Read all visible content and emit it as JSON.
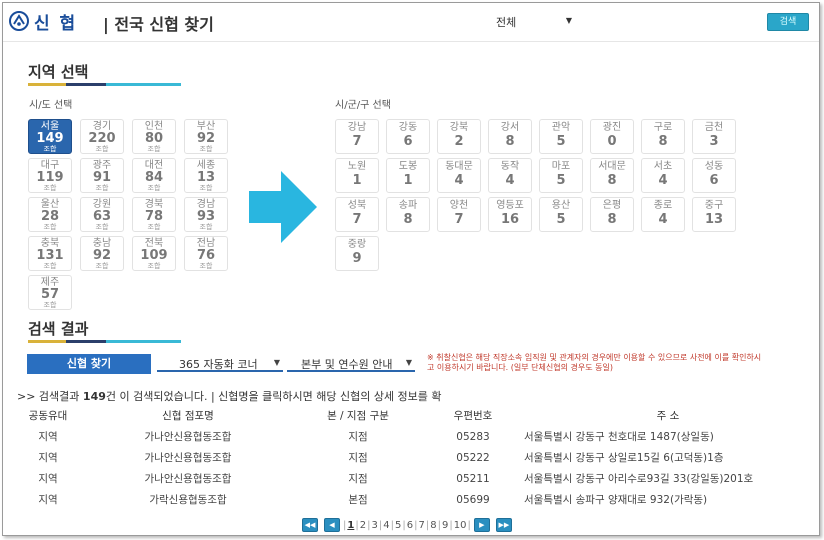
{
  "header": {
    "logo_text": "신 협",
    "title": "| 전국 신협 찾기",
    "region_select": "전체",
    "search_button": "검색"
  },
  "region_section": {
    "title": "지역 선택",
    "sido_label": "시/도 선택",
    "gu_label": "시/군/구 선택",
    "unit": "조합",
    "sido": [
      {
        "name": "서울",
        "count": "149",
        "selected": true
      },
      {
        "name": "경기",
        "count": "220"
      },
      {
        "name": "인천",
        "count": "80"
      },
      {
        "name": "부산",
        "count": "92"
      },
      {
        "name": "대구",
        "count": "119"
      },
      {
        "name": "광주",
        "count": "91"
      },
      {
        "name": "대전",
        "count": "84"
      },
      {
        "name": "세종",
        "count": "13"
      },
      {
        "name": "울산",
        "count": "28"
      },
      {
        "name": "강원",
        "count": "63"
      },
      {
        "name": "경북",
        "count": "78"
      },
      {
        "name": "경남",
        "count": "93"
      },
      {
        "name": "충북",
        "count": "131"
      },
      {
        "name": "충남",
        "count": "92"
      },
      {
        "name": "전북",
        "count": "109"
      },
      {
        "name": "전남",
        "count": "76"
      },
      {
        "name": "제주",
        "count": "57"
      }
    ],
    "gu": [
      {
        "name": "강남",
        "count": "7"
      },
      {
        "name": "강동",
        "count": "6"
      },
      {
        "name": "강북",
        "count": "2"
      },
      {
        "name": "강서",
        "count": "8"
      },
      {
        "name": "관악",
        "count": "5"
      },
      {
        "name": "광진",
        "count": "0"
      },
      {
        "name": "구로",
        "count": "8"
      },
      {
        "name": "금천",
        "count": "3"
      },
      {
        "name": "노원",
        "count": "1"
      },
      {
        "name": "도봉",
        "count": "1"
      },
      {
        "name": "동대문",
        "count": "4"
      },
      {
        "name": "동작",
        "count": "4"
      },
      {
        "name": "마포",
        "count": "5"
      },
      {
        "name": "서대문",
        "count": "8"
      },
      {
        "name": "서초",
        "count": "4"
      },
      {
        "name": "성동",
        "count": "6"
      },
      {
        "name": "성북",
        "count": "7"
      },
      {
        "name": "송파",
        "count": "8"
      },
      {
        "name": "양천",
        "count": "7"
      },
      {
        "name": "영등포",
        "count": "16"
      },
      {
        "name": "용산",
        "count": "5"
      },
      {
        "name": "은평",
        "count": "8"
      },
      {
        "name": "종로",
        "count": "4"
      },
      {
        "name": "중구",
        "count": "13"
      },
      {
        "name": "중랑",
        "count": "9"
      }
    ]
  },
  "results_section": {
    "title": "검색 결과",
    "tabs": {
      "find": "신협 찾기",
      "auto": "365 자동화 코너",
      "hq": "본부 및 연수원 안내"
    },
    "notice": "※ 취찰신협은 해당 직장소속 임직원 및 관계자의 경우에만 이용할 수 있으므로 사전에 이를 확인하시고 이용하시기 바랍니다. (일부 단체신협의 경우도 동일)",
    "summary_prefix": ">> 검색결과",
    "summary_count": "149",
    "summary_suffix": "건 이 검색되었습니다. | 신협명을 클릭하시면 해당 신협의 상세 정보를 확",
    "columns": [
      "공동유대",
      "신협 점포명",
      "본 / 지점 구분",
      "우편번호",
      "주 소"
    ],
    "rows": [
      [
        "지역",
        "가나안신용협동조합",
        "지점",
        "05283",
        "서울특별시 강동구 천호대로 1487(상일동)"
      ],
      [
        "지역",
        "가나안신용협동조합",
        "지점",
        "05222",
        "서울특별시 강동구 상일로15길 6(고덕동)1층"
      ],
      [
        "지역",
        "가나안신용협동조합",
        "지점",
        "05211",
        "서울특별시 강동구 아리수로93길 33(강일동)201호"
      ],
      [
        "지역",
        "가락신용협동조합",
        "본점",
        "05699",
        "서울특별시 송파구 양재대로 932(가락동)"
      ]
    ]
  },
  "pagination": {
    "first": "◀◀",
    "prev": "◀",
    "next": "▶",
    "last": "▶▶",
    "pages": [
      "1",
      "2",
      "3",
      "4",
      "5",
      "6",
      "7",
      "8",
      "9",
      "10"
    ],
    "current": "1"
  },
  "colors": {
    "accent_blue": "#2a66ad",
    "bar_yellow": "#d9b23a",
    "bar_navy": "#2b3f6b",
    "bar_cyan": "#39b9d6",
    "arrow_cyan": "#29b6e0"
  }
}
